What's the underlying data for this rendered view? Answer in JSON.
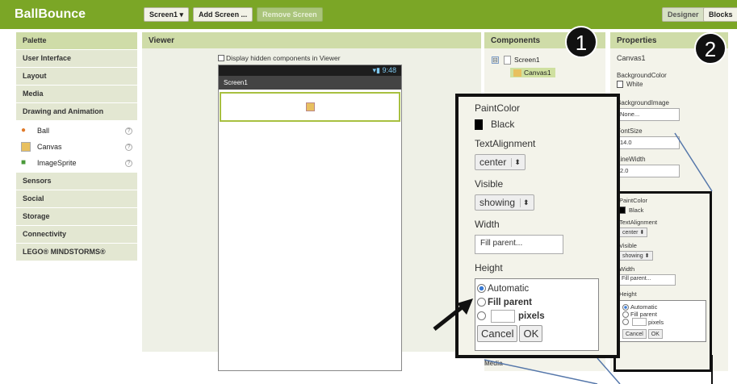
{
  "app": {
    "title": "BallBounce"
  },
  "toolbar": {
    "screen_select": "Screen1 ▾",
    "add_screen": "Add Screen ...",
    "remove_screen": "Remove Screen",
    "designer": "Designer",
    "blocks": "Blocks"
  },
  "palette": {
    "title": "Palette",
    "categories_top": [
      "User Interface",
      "Layout",
      "Media",
      "Drawing and Animation"
    ],
    "items": [
      {
        "label": "Ball",
        "icon": "ball-icon"
      },
      {
        "label": "Canvas",
        "icon": "canvas-icon"
      },
      {
        "label": "ImageSprite",
        "icon": "imagesprite-icon"
      }
    ],
    "categories_bottom": [
      "Sensors",
      "Social",
      "Storage",
      "Connectivity",
      "LEGO® MINDSTORMS®"
    ]
  },
  "viewer": {
    "title": "Viewer",
    "hidden_checkbox_label": "Display hidden components in Viewer",
    "status_time": "9:48",
    "screen_title": "Screen1"
  },
  "components": {
    "title": "Components",
    "tree_toggle": "⊟",
    "screen": "Screen1",
    "canvas": "Canvas1"
  },
  "properties": {
    "title": "Properties",
    "selected": "Canvas1",
    "bg_color_label": "BackgroundColor",
    "bg_color_value": "White",
    "bg_image_label": "BackgroundImage",
    "bg_image_value": "None...",
    "font_size_label": "FontSize",
    "font_size_value": "14.0",
    "line_width_label": "LineWidth",
    "line_width_value": "2.0"
  },
  "callouts": {
    "one": "1",
    "two": "2"
  },
  "zoom": {
    "paint_color_label": "PaintColor",
    "paint_color_value": "Black",
    "text_alignment_label": "TextAlignment",
    "text_alignment_value": "center",
    "visible_label": "Visible",
    "visible_value": "showing",
    "width_label": "Width",
    "width_value": "Fill parent...",
    "height_label": "Height",
    "height_auto": "Automatic",
    "height_fill": "Fill parent",
    "height_pixels": "pixels",
    "cancel": "Cancel",
    "ok": "OK"
  },
  "media_label": "Media",
  "colors": {
    "header_green": "#7ba626",
    "panel_head": "#cfdca8"
  }
}
